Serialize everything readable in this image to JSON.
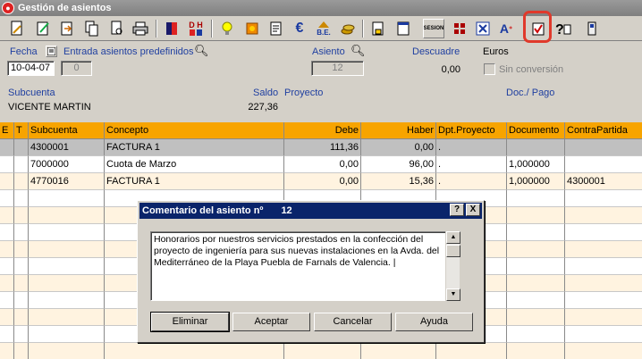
{
  "window": {
    "title": "Gestión de asientos"
  },
  "toolbar": {
    "icons": [
      "new-doc-icon",
      "edit-icon",
      "forward-icon",
      "copy-icon",
      "preview-icon",
      "print-icon",
      "cube-icon",
      "debe-haber-icon",
      "lightbulb-icon",
      "puzzle-icon",
      "notes-icon",
      "euro-icon",
      "be-icon",
      "coins-icon",
      "lock-icon",
      "calendar-icon",
      "sesion-icon",
      "grid-icon",
      "close-box-icon",
      "text-format-icon",
      "comment-icon",
      "help-icon",
      "exit-icon"
    ],
    "sesion_label": "SESION",
    "be_label": "B.E.",
    "dh_label": "D H"
  },
  "header": {
    "fecha_label": "Fecha",
    "fecha_value": "10-04-07",
    "predef_label": "Entrada asientos predefinidos",
    "predef_value": "0",
    "asiento_label": "Asiento",
    "asiento_value": "12",
    "descuadre_label": "Descuadre",
    "descuadre_value": "0,00",
    "euros_label": "Euros",
    "sin_conversion_label": "Sin conversión",
    "subcuenta_label": "Subcuenta",
    "subcuenta_value": "VICENTE MARTIN",
    "saldo_label": "Saldo",
    "saldo_value": "227,36",
    "proyecto_label": "Proyecto",
    "docpago_label": "Doc./ Pago"
  },
  "grid": {
    "columns": [
      "E",
      "T",
      "Subcuenta",
      "Concepto",
      "Debe",
      "Haber",
      "Dpt.Proyecto",
      "Documento",
      "ContraPartida"
    ],
    "rows": [
      {
        "subcuenta": "4300001",
        "concepto": "FACTURA 1",
        "debe": "111,36",
        "haber": "0,00",
        "dpt": ".",
        "documento": "",
        "contra": ""
      },
      {
        "subcuenta": "7000000",
        "concepto": "Cuota de Marzo",
        "debe": "0,00",
        "haber": "96,00",
        "dpt": ".",
        "documento": "1,000000",
        "contra": ""
      },
      {
        "subcuenta": "4770016",
        "concepto": "FACTURA 1",
        "debe": "0,00",
        "haber": "15,36",
        "dpt": ".",
        "documento": "1,000000",
        "contra": "4300001"
      }
    ]
  },
  "dialog": {
    "title": "Comentario del asiento nº",
    "number": "12",
    "help_btn": "?",
    "close_btn": "X",
    "comment_lines": [
      "Honorarios por nuestros servicios prestados en la confección del",
      "proyecto de ingeniería para sus nuevas instalaciones en la Avda. del",
      "Mediterráneo de la Playa Puebla de Farnals de Valencia.  |"
    ],
    "buttons": {
      "eliminar": "Eliminar",
      "aceptar": "Aceptar",
      "cancelar": "Cancelar",
      "ayuda": "Ayuda"
    }
  }
}
